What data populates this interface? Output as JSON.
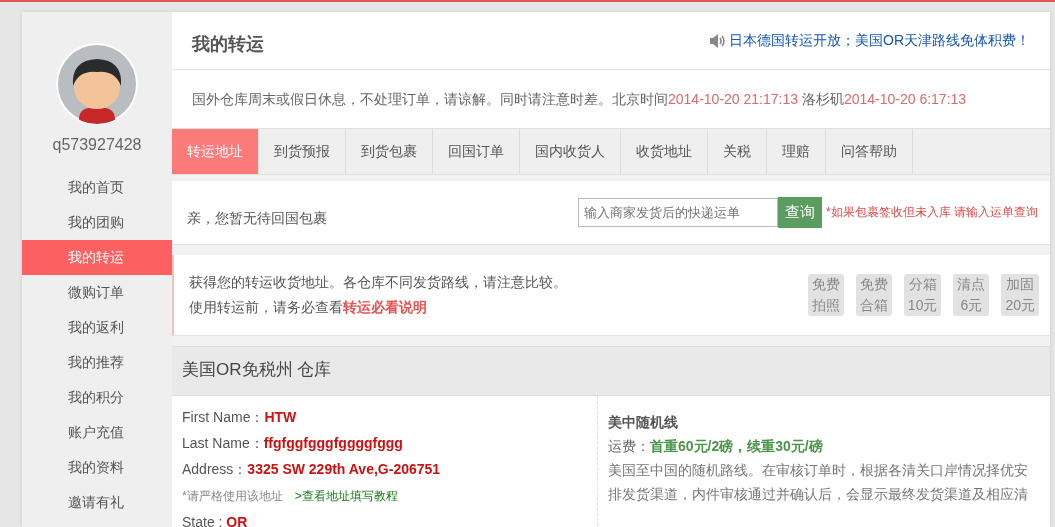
{
  "sidebar": {
    "username": "q573927428",
    "items": [
      {
        "label": "我的首页",
        "selected": false
      },
      {
        "label": "我的团购",
        "selected": false
      },
      {
        "label": "我的转运",
        "selected": true
      },
      {
        "label": "微购订单",
        "selected": false
      },
      {
        "label": "我的返利",
        "selected": false
      },
      {
        "label": "我的推荐",
        "selected": false
      },
      {
        "label": "我的积分",
        "selected": false
      },
      {
        "label": "账户充值",
        "selected": false
      },
      {
        "label": "我的资料",
        "selected": false
      },
      {
        "label": "邀请有礼",
        "selected": false
      }
    ]
  },
  "header": {
    "title": "我的转运",
    "announcement": "日本德国转运开放；美国OR天津路线免体积费！"
  },
  "notice_parts": [
    {
      "text": "国外仓库周末或假日休息，不处理订单，请谅解。同时请注意时差。北京时间",
      "highlight": false
    },
    {
      "text": "2014-10-20 21:17:13",
      "highlight": true
    },
    {
      "text": " 洛杉矶",
      "highlight": false
    },
    {
      "text": "2014-10-20 6:17:13",
      "highlight": true
    }
  ],
  "tabs": [
    {
      "label": "转运地址",
      "selected": true
    },
    {
      "label": "到货预报",
      "selected": false
    },
    {
      "label": "到货包裹",
      "selected": false
    },
    {
      "label": "回国订单",
      "selected": false
    },
    {
      "label": "国内收货人",
      "selected": false
    },
    {
      "label": "收货地址",
      "selected": false
    },
    {
      "label": "关税",
      "selected": false
    },
    {
      "label": "理赔",
      "selected": false
    },
    {
      "label": "问答帮助",
      "selected": false
    }
  ],
  "query": {
    "message": "亲，您暂无待回国包裹",
    "placeholder": "输入商家发货后的快递运单",
    "button": "查询",
    "hint": "*如果包裹签收但未入库 请输入运单查询"
  },
  "intro": {
    "line1": "获得您的转运收货地址。各仓库不同发货路线，请注意比较。",
    "line2": "使用转运前，请务必查看",
    "link": "转运必看说明",
    "badges": [
      {
        "line1": "免费",
        "line2": "拍照"
      },
      {
        "line1": "免费",
        "line2": "合箱"
      },
      {
        "line1": "分箱",
        "line2": "10元"
      },
      {
        "line1": "清点",
        "line2": "6元"
      },
      {
        "line1": "加固",
        "line2": "20元"
      }
    ]
  },
  "warehouse": {
    "title": "美国OR免税州 仓库",
    "fields": [
      {
        "label": "First Name：",
        "value": "HTW"
      },
      {
        "label": "Last Name：",
        "value": "ffgfggfgggfggggfggg"
      },
      {
        "label": "Address：",
        "value": "3325 SW 229th Ave,G-206751"
      }
    ],
    "hint": "*请严格使用该地址",
    "hint_link": ">查看地址填写教程",
    "state": {
      "label": "State : ",
      "value": "OR"
    },
    "route": {
      "name": "美中随机线",
      "fee": "运费：**首重60元/2磅，续重30元/磅**",
      "description": "美国至中国的随机路线。在审核订单时，根据各清关口岸情况择优安排发货渠道，内件审核通过并确认后，会显示最终发货渠道及相应清"
    }
  }
}
